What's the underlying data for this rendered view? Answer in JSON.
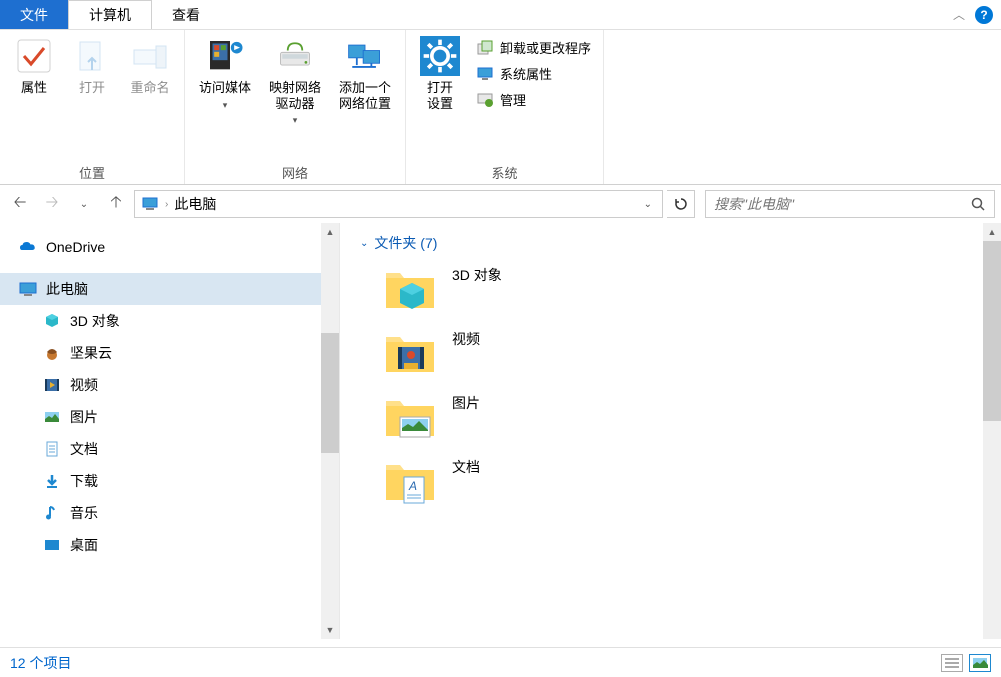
{
  "tabs": {
    "file": "文件",
    "computer": "计算机",
    "view": "查看"
  },
  "ribbon": {
    "location": {
      "label": "位置",
      "props": "属性",
      "open": "打开",
      "rename": "重命名"
    },
    "network": {
      "label": "网络",
      "media": "访问媒体",
      "map": "映射网络\n驱动器",
      "addloc": "添加一个\n网络位置"
    },
    "system": {
      "label": "系统",
      "opensettings": "打开\n设置",
      "uninstall": "卸载或更改程序",
      "sysprops": "系统属性",
      "manage": "管理"
    }
  },
  "nav": {
    "address": "此电脑",
    "search_placeholder": "搜索\"此电脑\""
  },
  "sidebar": {
    "onedrive": "OneDrive",
    "thispc": "此电脑",
    "children": [
      "3D 对象",
      "坚果云",
      "视频",
      "图片",
      "文档",
      "下载",
      "音乐",
      "桌面"
    ]
  },
  "content": {
    "group_label": "文件夹 (7)",
    "items": [
      "3D 对象",
      "视频",
      "图片",
      "文档"
    ]
  },
  "status": {
    "count": "12 个项目"
  }
}
